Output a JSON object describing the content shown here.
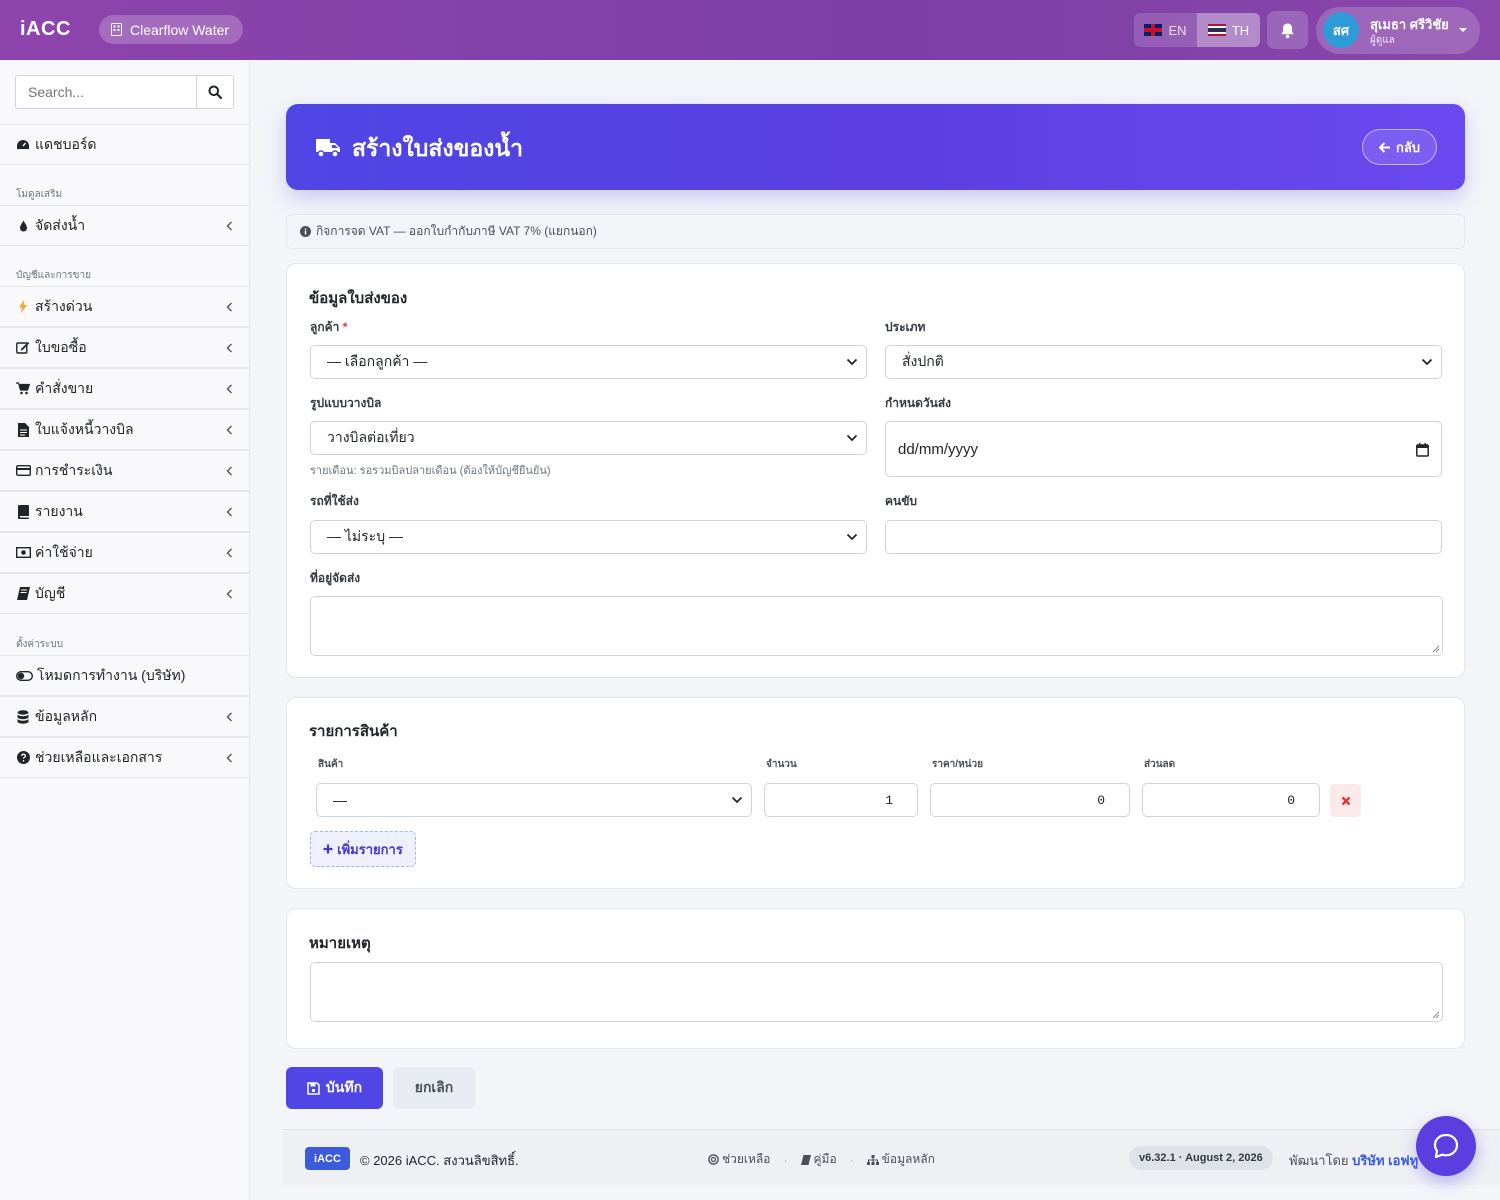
{
  "topbar": {
    "brand": "iACC",
    "company": "Clearflow Water",
    "languages": [
      {
        "code": "EN",
        "active": false
      },
      {
        "code": "TH",
        "active": true
      }
    ],
    "user": {
      "initials": "สศ",
      "name": "สุเมธา ศรีวิชัย",
      "role": "ผู้ดูแล"
    }
  },
  "sidebar": {
    "search_placeholder": "Search...",
    "dashboard": "แดชบอร์ด",
    "section_addons": "โมดูลเสริม",
    "water_delivery": "จัดส่งน้ำ",
    "section_accounting": "บัญชีและการขาย",
    "items": [
      {
        "label": "สร้างด่วน",
        "icon": "bolt-icon"
      },
      {
        "label": "ใบขอซื้อ",
        "icon": "edit-icon"
      },
      {
        "label": "คำสั่งขาย",
        "icon": "cart-icon"
      },
      {
        "label": "ใบแจ้งหนี้วางบิล",
        "icon": "file-icon"
      },
      {
        "label": "การชำระเงิน",
        "icon": "credit-card-icon"
      },
      {
        "label": "รายงาน",
        "icon": "book-icon"
      },
      {
        "label": "ค่าใช้จ่าย",
        "icon": "money-icon"
      },
      {
        "label": "บัญชี",
        "icon": "ledger-icon"
      }
    ],
    "section_settings": "ตั้งค่าระบบ",
    "mode": "โหมดการทำงาน (บริษัท)",
    "master_data": "ข้อมูลหลัก",
    "help": "ช่วยเหลือและเอกสาร"
  },
  "hero": {
    "title": "สร้างใบส่งของน้ำ",
    "back": "กลับ"
  },
  "vat_notice": "กิจการจด VAT — ออกใบกำกับภาษี VAT 7% (แยกนอก)",
  "delivery_info": {
    "title": "ข้อมูลใบส่งของ",
    "customer_label": "ลูกค้า",
    "customer_required": "*",
    "customer_value": "— เลือกลูกค้า —",
    "type_label": "ประเภท",
    "type_value": "สั่งปกติ",
    "billing_label": "รูปแบบวางบิล",
    "billing_value": "วางบิลต่อเที่ยว",
    "billing_help": "รายเดือน: รอรวมบิลปลายเดือน (ต้องให้บัญชียืนยัน)",
    "due_label": "กำหนดวันส่ง",
    "due_placeholder": "dd/mm/yyyy",
    "vehicle_label": "รถที่ใช้ส่ง",
    "vehicle_value": "— ไม่ระบุ —",
    "driver_label": "คนขับ",
    "driver_value": "",
    "address_label": "ที่อยู่จัดส่ง",
    "address_value": ""
  },
  "items_section": {
    "title": "รายการสินค้า",
    "col_product": "สินค้า",
    "col_qty": "จำนวน",
    "col_price": "ราคา/หน่วย",
    "col_discount": "ส่วนลด",
    "rows": [
      {
        "product": "—",
        "qty": "1",
        "price": "0",
        "discount": "0"
      }
    ],
    "add_label": "เพิ่มรายการ"
  },
  "notes": {
    "title": "หมายเหตุ",
    "value": ""
  },
  "actions": {
    "save": "บันทึก",
    "cancel": "ยกเลิก"
  },
  "footer": {
    "logo": "iACC",
    "copyright": "© 2026 iACC. สงวนลิขสิทธิ์.",
    "links": [
      "ช่วยเหลือ",
      "คู่มือ",
      "ข้อมูลหลัก"
    ],
    "version": "v6.32.1 · August 2, 2026",
    "developed_by": "พัฒนาโดย",
    "developer": "บริษัท เอฟทู"
  },
  "colors": {
    "primary": "#4f46e5",
    "topbar": "#8e44ad",
    "danger": "#dc3545"
  }
}
